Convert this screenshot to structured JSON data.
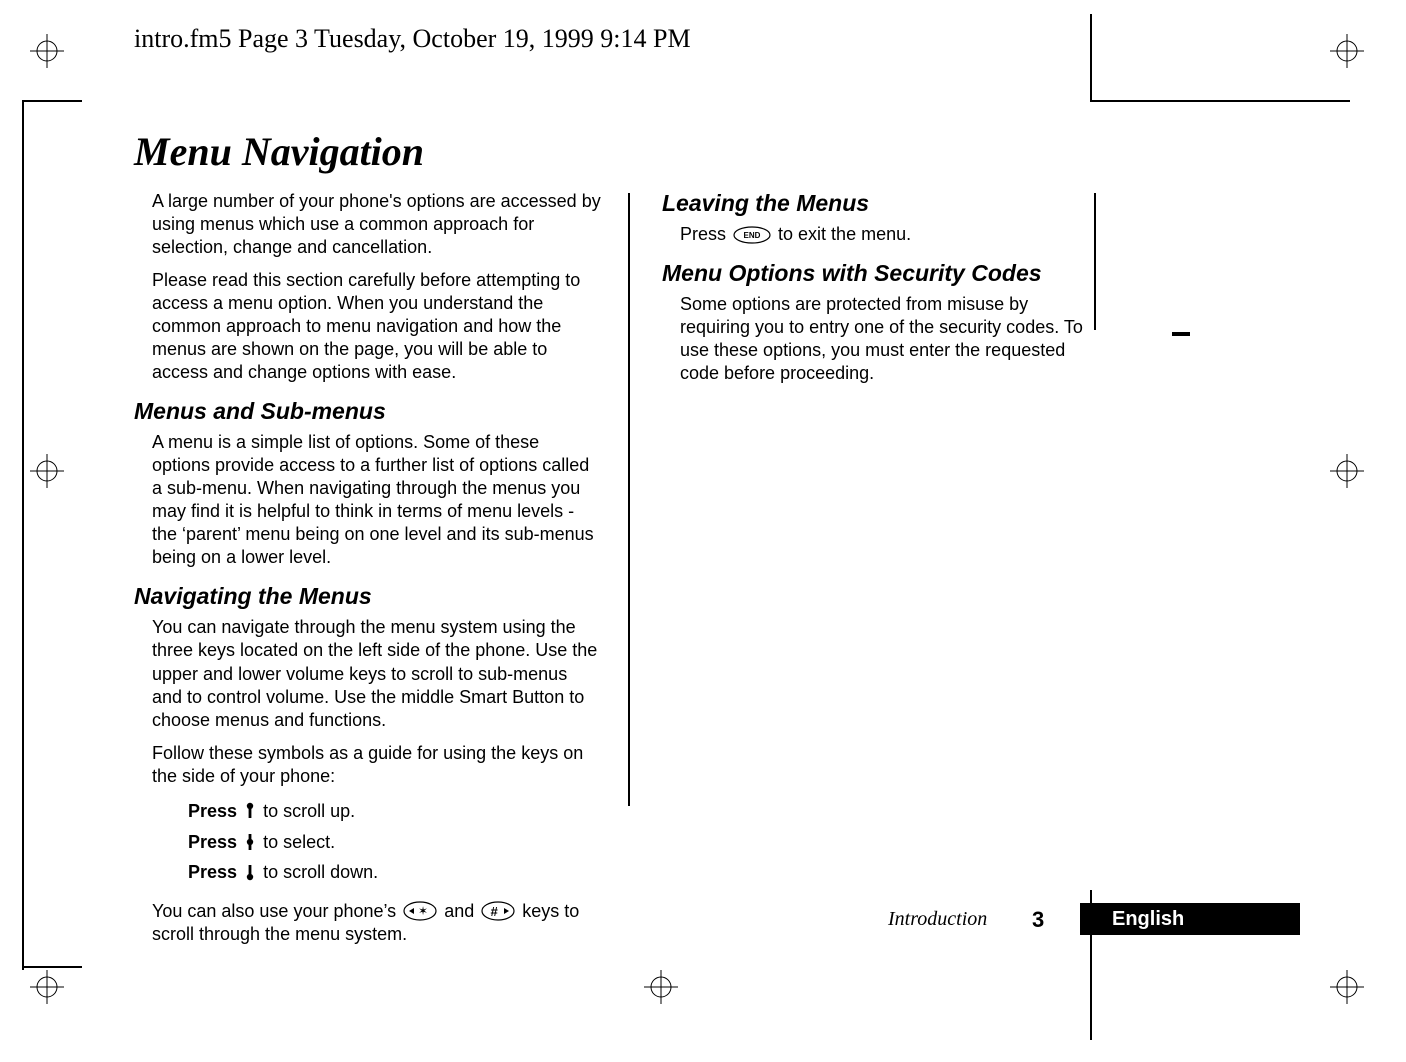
{
  "fm_header": "intro.fm5  Page 3  Tuesday, October 19, 1999  9:14 PM",
  "title": "Menu Navigation",
  "left": {
    "intro1": "A large number of your phone's options are accessed by using menus which use a common approach for selection, change and cancellation.",
    "intro2": "Please read this section carefully before attempting to access a menu option. When you understand the common approach to menu navigation and how the menus are shown on the page, you will be able to access and change options with ease.",
    "h1": "Menus and Sub-menus",
    "p1": "A menu is a simple list of options. Some of these options provide access to a further list of options called a sub-menu. When navigating through the menus you may find it is helpful to think in terms of menu levels - the ‘parent’ menu being on one level and its sub-menus being on a lower level.",
    "h2": "Navigating the Menus",
    "p2": "You can navigate through the menu system using the three keys located on the left side of the phone. Use the upper and lower volume keys to scroll to sub-menus and to control volume. Use the middle Smart Button to choose menus and functions.",
    "p3": "Follow these symbols as a guide for using the keys on the side of your phone:",
    "press_up_lead": "Press ",
    "press_up_rest": " to scroll up.",
    "press_sel_lead": "Press ",
    "press_sel_rest": " to select.",
    "press_dn_lead": "Press ",
    "press_dn_rest": " to scroll down.",
    "p4a": "You can also use your phone’s ",
    "p4b": " and ",
    "p4c": " keys to scroll through the menu system.",
    "key_star": "✶",
    "key_hash": "#"
  },
  "right": {
    "h1": "Leaving the Menus",
    "p1a": "Press ",
    "p1b": " to exit the menu.",
    "end_label": "END",
    "h2": "Menu Options with Security Codes",
    "p2": "Some options are protected from misuse by requiring you to entry one of the security codes. To use these options, you must enter the requested code before proceeding."
  },
  "footer": {
    "section": "Introduction",
    "page": "3",
    "lang": "English"
  }
}
